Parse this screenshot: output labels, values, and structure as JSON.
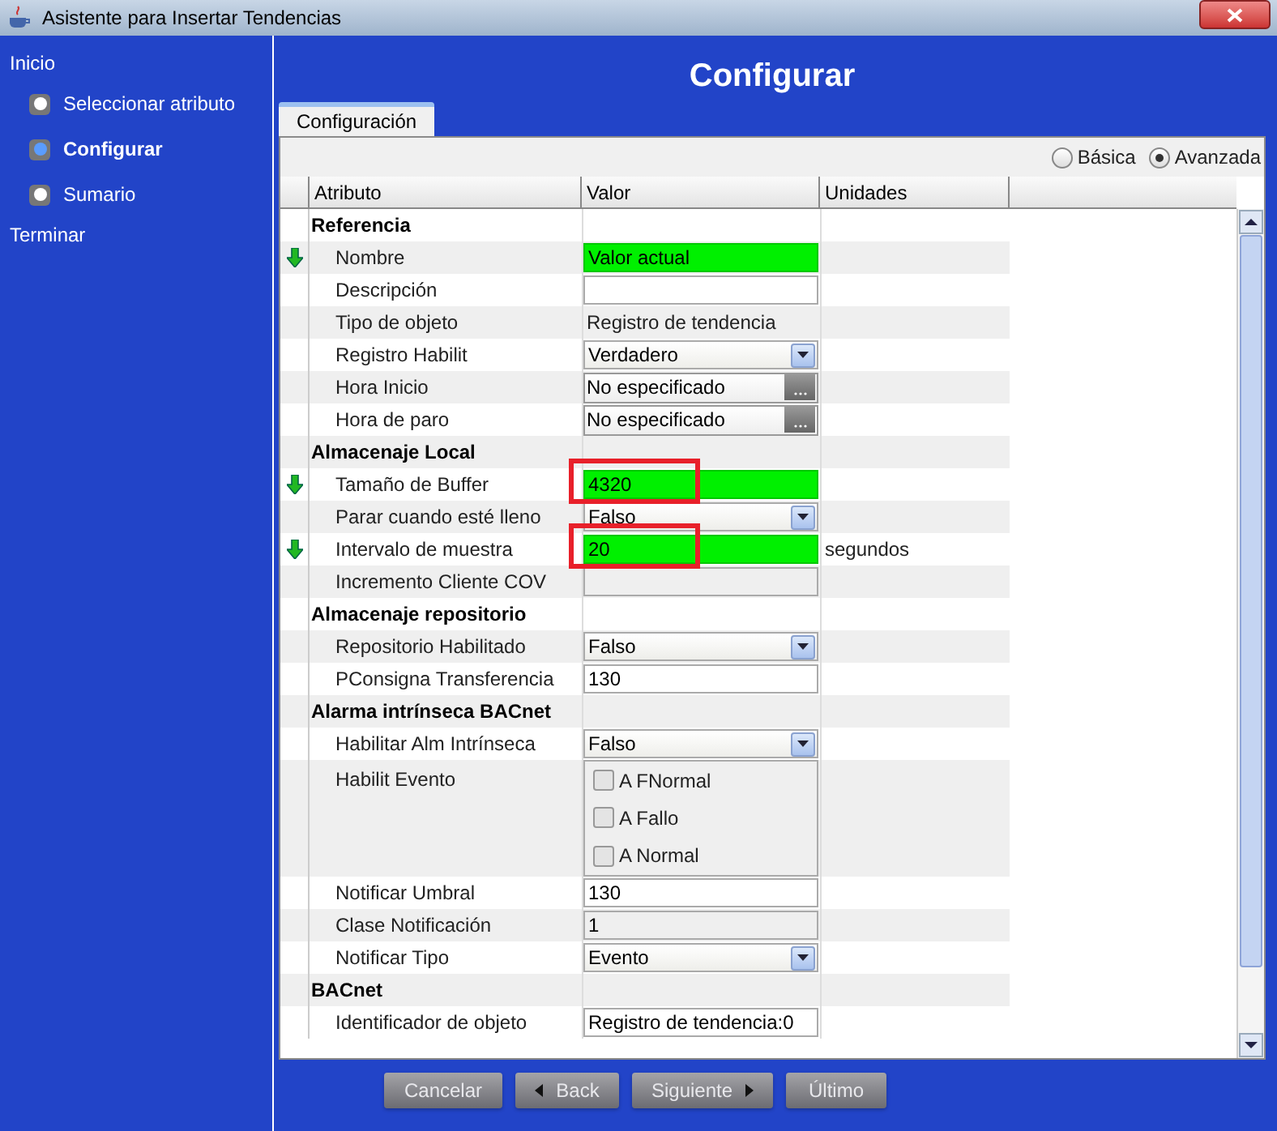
{
  "window": {
    "title": "Asistente para Insertar Tendencias"
  },
  "steps": [
    {
      "label": "Inicio",
      "kind": "section",
      "selected": false
    },
    {
      "label": "Seleccionar atributo",
      "kind": "step",
      "selected": false
    },
    {
      "label": "Configurar",
      "kind": "step",
      "selected": true
    },
    {
      "label": "Sumario",
      "kind": "step",
      "selected": false
    },
    {
      "label": "Terminar",
      "kind": "section",
      "selected": false
    }
  ],
  "heading": "Configurar",
  "tabs": [
    {
      "label": "Configuración",
      "selected": true
    }
  ],
  "view_modes": [
    {
      "label": "Básica",
      "selected": false
    },
    {
      "label": "Avanzada",
      "selected": true
    }
  ],
  "table": {
    "columns": [
      "Atributo",
      "Valor",
      "Unidades"
    ],
    "rows": [
      {
        "kind": "group",
        "label": "Referencia"
      },
      {
        "kind": "input",
        "label": "Nombre",
        "value": "Valor actual",
        "modified": true,
        "highlighted": false,
        "disabled": false
      },
      {
        "kind": "input",
        "label": "Descripción",
        "modified": false,
        "highlighted": false,
        "disabled": false
      },
      {
        "kind": "text",
        "label": "Tipo de objeto",
        "value": "Registro de tendencia"
      },
      {
        "kind": "dropdown",
        "label": "Registro Habilit",
        "value": "Verdadero"
      },
      {
        "kind": "picker",
        "label": "Hora Inicio",
        "value": "No especificado"
      },
      {
        "kind": "picker",
        "label": "Hora de paro",
        "value": "No especificado"
      },
      {
        "kind": "group",
        "label": "Almacenaje Local"
      },
      {
        "kind": "input",
        "label": "Tamaño de Buffer",
        "value": "4320",
        "modified": true,
        "highlighted": true,
        "disabled": false
      },
      {
        "kind": "dropdown",
        "label": "Parar cuando esté lleno",
        "value": "Falso"
      },
      {
        "kind": "input",
        "label": "Intervalo de muestra",
        "value": "20",
        "units": "segundos",
        "modified": true,
        "highlighted": true,
        "disabled": false
      },
      {
        "kind": "input",
        "label": "Incremento Cliente COV",
        "modified": false,
        "highlighted": false,
        "disabled": true
      },
      {
        "kind": "group",
        "label": "Almacenaje repositorio"
      },
      {
        "kind": "dropdown",
        "label": "Repositorio Habilitado",
        "value": "Falso"
      },
      {
        "kind": "input",
        "label": "PConsigna Transferencia",
        "value": "130",
        "modified": false,
        "highlighted": false,
        "disabled": false
      },
      {
        "kind": "group",
        "label": "Alarma intrínseca BACnet"
      },
      {
        "kind": "dropdown",
        "label": "Habilitar Alm Intrínseca",
        "value": "Falso"
      },
      {
        "kind": "checks",
        "label": "Habilit Evento",
        "options": [
          {
            "label": "A FNormal",
            "checked": false
          },
          {
            "label": "A Fallo",
            "checked": false
          },
          {
            "label": "A Normal",
            "checked": false
          }
        ]
      },
      {
        "kind": "input",
        "label": "Notificar Umbral",
        "value": "130",
        "modified": false,
        "highlighted": false,
        "disabled": false
      },
      {
        "kind": "input",
        "label": "Clase Notificación",
        "value": "1",
        "modified": false,
        "highlighted": false,
        "disabled": true
      },
      {
        "kind": "dropdown",
        "label": "Notificar Tipo",
        "value": "Evento"
      },
      {
        "kind": "group",
        "label": "BACnet"
      },
      {
        "kind": "input",
        "label": "Identificador de objeto",
        "value": "Registro de tendencia:0",
        "modified": false,
        "highlighted": false,
        "disabled": false
      }
    ]
  },
  "buttons": [
    {
      "label": "Cancelar",
      "kind": "plain"
    },
    {
      "label": "Back",
      "kind": "back"
    },
    {
      "label": "Siguiente",
      "kind": "next"
    },
    {
      "label": "Último",
      "kind": "plain"
    }
  ]
}
